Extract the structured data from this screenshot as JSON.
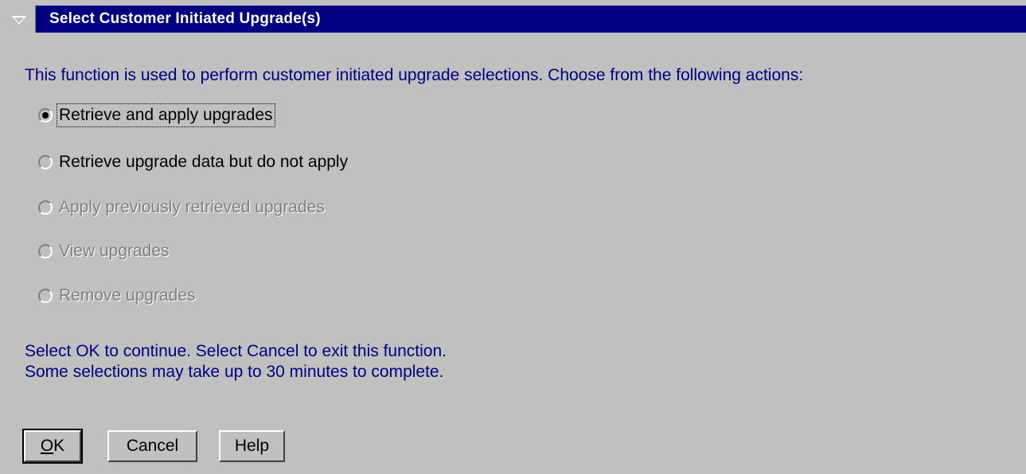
{
  "window": {
    "title": "Select Customer Initiated Upgrade(s)",
    "icon": "system-menu-icon"
  },
  "intro": "This function is used to perform customer initiated upgrade selections.  Choose from the following actions:",
  "options": [
    {
      "label": "Retrieve and apply upgrades",
      "selected": true,
      "enabled": true
    },
    {
      "label": "Retrieve upgrade data but do not apply",
      "selected": false,
      "enabled": true
    },
    {
      "label": "Apply previously retrieved upgrades",
      "selected": false,
      "enabled": false
    },
    {
      "label": "View upgrades",
      "selected": false,
      "enabled": false
    },
    {
      "label": "Remove upgrades",
      "selected": false,
      "enabled": false
    }
  ],
  "footer": {
    "line1": "Select OK to continue.  Select Cancel to exit this function.",
    "line2": "Some selections may take up to 30 minutes to complete."
  },
  "buttons": {
    "ok_mnemonic": "O",
    "ok_rest": "K",
    "cancel": "Cancel",
    "help": "Help"
  },
  "colors": {
    "titlebar": "#000080",
    "background": "#c0c0c0",
    "info_text": "#000080",
    "disabled_text": "#808080"
  }
}
